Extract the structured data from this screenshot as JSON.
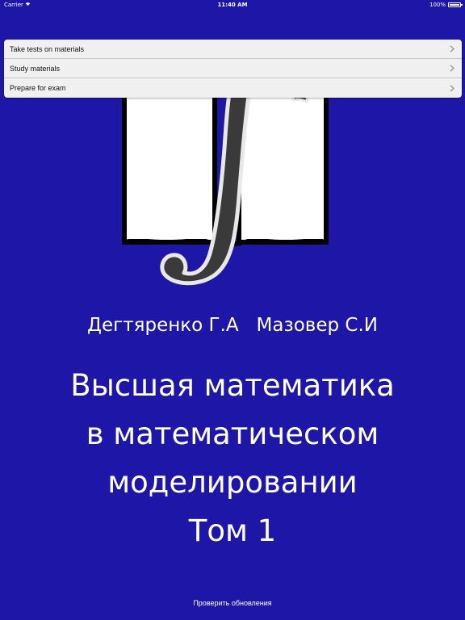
{
  "status_bar": {
    "carrier": "Carrier",
    "time": "11:40 AM",
    "battery": "100%"
  },
  "menu": {
    "items": [
      {
        "label": "Take tests on materials",
        "icon": "chevron-right-icon"
      },
      {
        "label": "Study materials",
        "icon": "chevron-right-icon"
      },
      {
        "label": "Prepare for exam",
        "icon": "chevron-right-icon"
      }
    ]
  },
  "cover": {
    "logo": "book-integral-icon",
    "authors": "Дегтяренко Г.А   Мазовер С.И",
    "title_lines": [
      "Высшая математика",
      "в математическом",
      "моделировании",
      "Том 1"
    ]
  },
  "footer": {
    "update_link": "Проверить обновления"
  },
  "colors": {
    "background": "#1e16a6",
    "menu_background": "#f0f0f0",
    "text_on_background": "#ffffff",
    "integral_fill": "#3a3a3a"
  }
}
